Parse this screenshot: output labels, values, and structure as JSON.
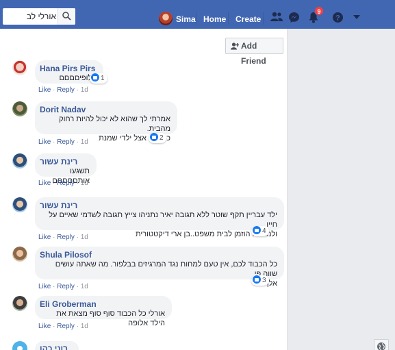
{
  "topbar": {
    "search_value": "אורלי לב",
    "profile_name": "Sima",
    "home_label": "Home",
    "create_label": "Create",
    "notification_count": "9",
    "icons": [
      "search-icon",
      "friends-icon",
      "messenger-icon",
      "notifications-icon",
      "help-icon",
      "chevron-down-icon"
    ]
  },
  "feed": {
    "add_friend_label": "Add Friend",
    "comments": [
      {
        "author": "Hana Pirs Pirs",
        "lines": [
          "אלופיםםםם"
        ],
        "reactions": "1",
        "like": "Like",
        "reply": "Reply",
        "dot": "·",
        "time": "1d"
      },
      {
        "author": "Dorit Nadav",
        "lines": [
          "אמרתי לך שהוא לא יכול להיות רחוק מהבית.",
          "ככה זה אצל ילדי שמנת"
        ],
        "reactions": "2",
        "like": "Like",
        "reply": "Reply",
        "dot": "·",
        "time": "1d"
      },
      {
        "author": "רינת עשור",
        "lines": [
          "תשגעו אותםםםםם"
        ],
        "reactions": "",
        "like": "Like",
        "reply": "Reply",
        "dot": "·",
        "time": "1d"
      },
      {
        "author": "רינת עשור",
        "lines": [
          "ילד עבריין תקף שוטר ללא תגובה יאיר נתניהו צייץ תגובה לשדמי שאיים על חייו",
          "ולמחרת הוזמן לבית משפט..בן ארי דיקטטורית"
        ],
        "reactions": "4",
        "like": "Like",
        "reply": "Reply",
        "dot": "·",
        "time": "1d"
      },
      {
        "author": "Shula Pilosof",
        "lines": [
          "כל הכבוד לכם, אין טעם למחות נגד המרגיזים בבלפור. מה שאתה עושים שווה פי",
          "אלף."
        ],
        "reactions": "3",
        "like": "Like",
        "reply": "Reply",
        "dot": "·",
        "time": "1d"
      },
      {
        "author": "Eli Groberman",
        "lines": [
          "אורלי כל הכבוד סוף סוף מצאת את הילד אלופה"
        ],
        "reactions": "",
        "like": "Like",
        "reply": "Reply",
        "dot": "·",
        "time": "1d"
      },
      {
        "author": "רוני כהן",
        "lines": [],
        "reactions": "",
        "like": "",
        "reply": "",
        "dot": "",
        "time": ""
      }
    ]
  },
  "colors": {
    "brand": "#4267b2",
    "link": "#385898",
    "like_blue": "#1877f2",
    "badge_red": "#fa3e3e"
  }
}
